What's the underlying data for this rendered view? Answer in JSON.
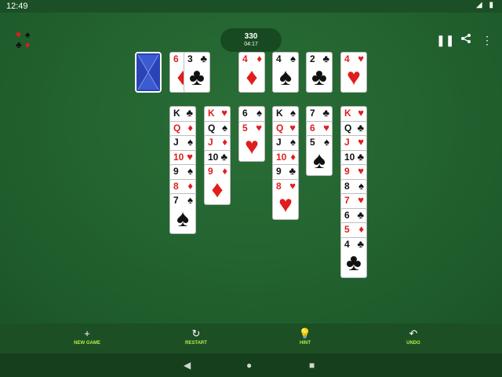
{
  "status_bar": {
    "time": "12:49",
    "icons": "◢ ▮"
  },
  "header": {
    "score": "330",
    "timer": "04:17"
  },
  "logo": {
    "suits": [
      "♥",
      "♠",
      "♣",
      "♦"
    ]
  },
  "top_controls": {
    "pause_icon": "pause-icon",
    "share_icon": "share-icon",
    "menu_icon": "more-vert-icon"
  },
  "colors": {
    "table": "#22622f",
    "card_red": "#e11d1d",
    "card_back": "#2a44b8",
    "accent": "#b8e84a"
  },
  "waste": [
    {
      "rank": "6",
      "suit": "♦",
      "color": "red"
    },
    {
      "rank": "3",
      "suit": "♣",
      "color": "black"
    }
  ],
  "foundations": [
    {
      "rank": "4",
      "suit": "♦",
      "color": "red"
    },
    {
      "rank": "4",
      "suit": "♠",
      "color": "black"
    },
    {
      "rank": "2",
      "suit": "♣",
      "color": "black"
    },
    {
      "rank": "4",
      "suit": "♥",
      "color": "red"
    }
  ],
  "tableau": [
    [
      {
        "rank": "K",
        "suit": "♣",
        "color": "black"
      },
      {
        "rank": "Q",
        "suit": "♦",
        "color": "red"
      },
      {
        "rank": "J",
        "suit": "♠",
        "color": "black"
      },
      {
        "rank": "10",
        "suit": "♥",
        "color": "red"
      },
      {
        "rank": "9",
        "suit": "♠",
        "color": "black"
      },
      {
        "rank": "8",
        "suit": "♦",
        "color": "red"
      },
      {
        "rank": "7",
        "suit": "♠",
        "color": "black"
      }
    ],
    [
      {
        "rank": "K",
        "suit": "♥",
        "color": "red"
      },
      {
        "rank": "Q",
        "suit": "♠",
        "color": "black"
      },
      {
        "rank": "J",
        "suit": "♦",
        "color": "red"
      },
      {
        "rank": "10",
        "suit": "♣",
        "color": "black"
      },
      {
        "rank": "9",
        "suit": "♦",
        "color": "red"
      }
    ],
    [
      {
        "rank": "6",
        "suit": "♠",
        "color": "black"
      },
      {
        "rank": "5",
        "suit": "♥",
        "color": "red"
      }
    ],
    [
      {
        "rank": "K",
        "suit": "♠",
        "color": "black"
      },
      {
        "rank": "Q",
        "suit": "♥",
        "color": "red"
      },
      {
        "rank": "J",
        "suit": "♠",
        "color": "black"
      },
      {
        "rank": "10",
        "suit": "♦",
        "color": "red"
      },
      {
        "rank": "9",
        "suit": "♣",
        "color": "black"
      },
      {
        "rank": "8",
        "suit": "♥",
        "color": "red"
      }
    ],
    [
      {
        "rank": "7",
        "suit": "♣",
        "color": "black"
      },
      {
        "rank": "6",
        "suit": "♥",
        "color": "red"
      },
      {
        "rank": "5",
        "suit": "♠",
        "color": "black"
      }
    ],
    [
      {
        "rank": "K",
        "suit": "♥",
        "color": "red"
      },
      {
        "rank": "Q",
        "suit": "♣",
        "color": "black"
      },
      {
        "rank": "J",
        "suit": "♥",
        "color": "red"
      },
      {
        "rank": "10",
        "suit": "♣",
        "color": "black"
      },
      {
        "rank": "9",
        "suit": "♥",
        "color": "red"
      },
      {
        "rank": "8",
        "suit": "♠",
        "color": "black"
      },
      {
        "rank": "7",
        "suit": "♥",
        "color": "red"
      },
      {
        "rank": "6",
        "suit": "♣",
        "color": "black"
      },
      {
        "rank": "5",
        "suit": "♦",
        "color": "red"
      },
      {
        "rank": "4",
        "suit": "♣",
        "color": "black"
      }
    ]
  ],
  "bottom_bar": {
    "new_game": {
      "label": "NEW GAME",
      "icon": "+"
    },
    "restart": {
      "label": "RESTART",
      "icon": "↻"
    },
    "hint": {
      "label": "HINT",
      "icon": "💡"
    },
    "undo": {
      "label": "UNDO",
      "icon": "↶"
    }
  },
  "nav_bar": {
    "back": "◀",
    "home": "●",
    "recents": "■"
  }
}
